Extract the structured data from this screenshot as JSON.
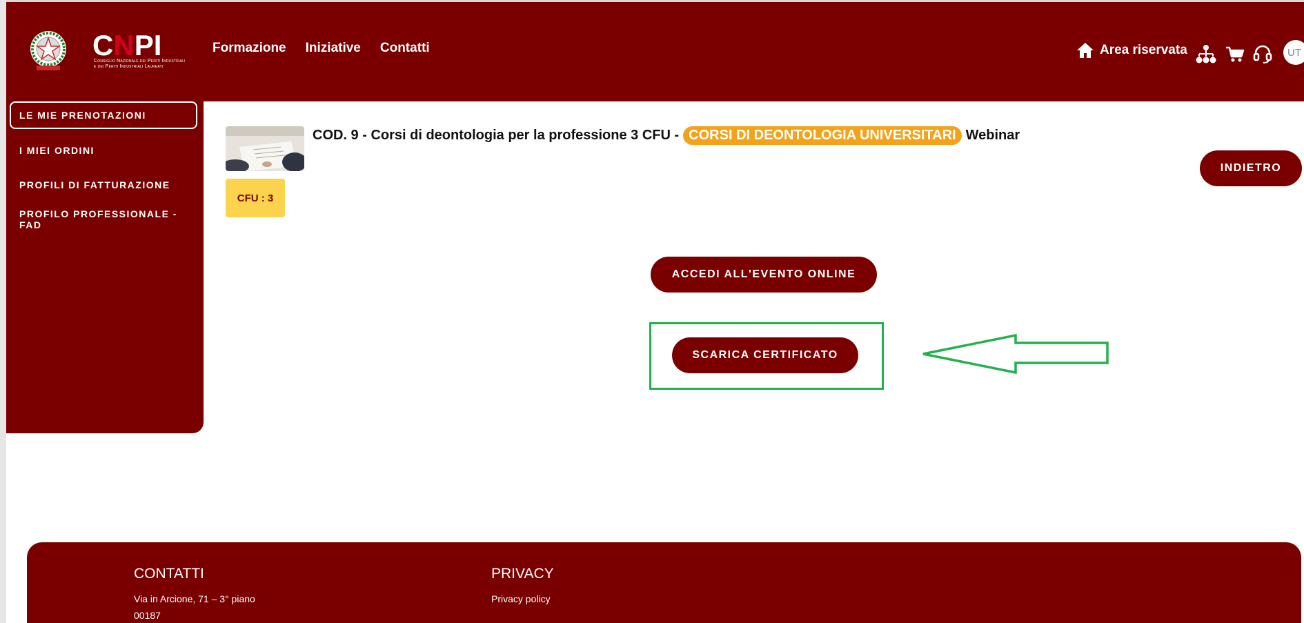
{
  "header": {
    "logo": {
      "wordmark": "CNPI",
      "subtitle_line1": "Consiglio Nazionale dei Periti Industriali",
      "subtitle_line2": "e dei Periti Industriali Laureati"
    },
    "nav": [
      {
        "label": "Formazione"
      },
      {
        "label": "Iniziative"
      },
      {
        "label": "Contatti"
      }
    ],
    "area_riservata": "Area riservata",
    "icons": [
      "home-icon",
      "sitemap-icon",
      "cart-icon",
      "headset-icon"
    ],
    "avatar_initials": "UT"
  },
  "sidebar": {
    "items": [
      {
        "label": "LE MIE PRENOTAZIONI",
        "active": true
      },
      {
        "label": "I MIEI ORDINI",
        "active": false
      },
      {
        "label": "PROFILI DI FATTURAZIONE",
        "active": false
      },
      {
        "label": "PROFILO PROFESSIONALE - FAD",
        "active": false
      }
    ]
  },
  "course": {
    "title": "COD. 9 - Corsi di deontologia per la professione 3 CFU -",
    "tag": "CORSI DI DEONTOLOGIA UNIVERSITARI",
    "mode": "Webinar",
    "cfu": "CFU : 3"
  },
  "buttons": {
    "back": "INDIETRO",
    "access": "ACCEDI ALL'EVENTO ONLINE",
    "certificate": "SCARICA CERTIFICATO"
  },
  "footer": {
    "contatti_title": "CONTATTI",
    "address_line1": "Via in Arcione, 71 – 3° piano",
    "address_line2": "00187",
    "privacy_title": "PRIVACY",
    "privacy_link": "Privacy policy"
  },
  "colors": {
    "brand": "#7a0000",
    "accent_tag": "#f2a31b",
    "cfu_badge": "#fcd34d",
    "annotation": "#22b14c"
  }
}
